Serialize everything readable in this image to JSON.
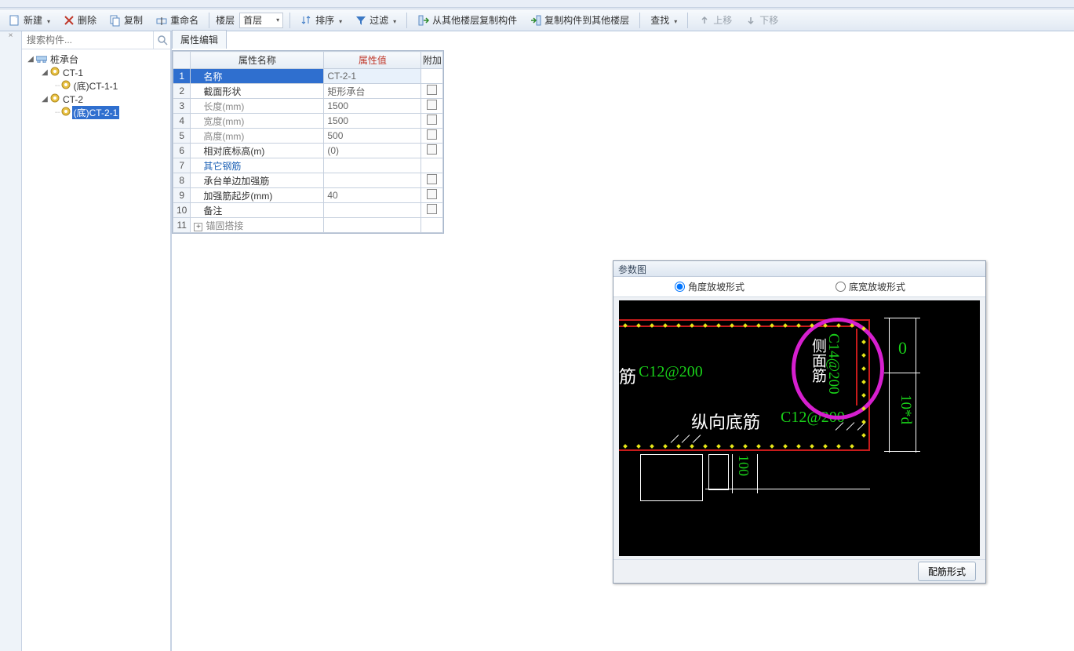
{
  "toolbar": {
    "new": "新建",
    "delete": "删除",
    "copy": "复制",
    "rename": "重命名",
    "floor": "楼层",
    "firstFloor": "首层",
    "sort": "排序",
    "filter": "过滤",
    "copyFromOther": "从其他楼层复制构件",
    "copyToOther": "复制构件到其他楼层",
    "find": "查找",
    "moveUp": "上移",
    "moveDown": "下移"
  },
  "search": {
    "placeholder": "搜索构件..."
  },
  "tree": {
    "root": "桩承台",
    "ct1": "CT-1",
    "ct1child": "(底)CT-1-1",
    "ct2": "CT-2",
    "ct2child": "(底)CT-2-1"
  },
  "propTab": "属性编辑",
  "propHeaders": {
    "name": "属性名称",
    "value": "属性值",
    "extra": "附加"
  },
  "props": {
    "r1": {
      "n": "1",
      "name": "名称",
      "value": "CT-2-1"
    },
    "r2": {
      "n": "2",
      "name": "截面形状",
      "value": "矩形承台"
    },
    "r3": {
      "n": "3",
      "name": "长度(mm)",
      "value": "1500"
    },
    "r4": {
      "n": "4",
      "name": "宽度(mm)",
      "value": "1500"
    },
    "r5": {
      "n": "5",
      "name": "高度(mm)",
      "value": "500"
    },
    "r6": {
      "n": "6",
      "name": "相对底标高(m)",
      "value": "(0)"
    },
    "r7": {
      "n": "7",
      "name": "其它钢筋",
      "value": ""
    },
    "r8": {
      "n": "8",
      "name": "承台单边加强筋",
      "value": ""
    },
    "r9": {
      "n": "9",
      "name": "加强筋起步(mm)",
      "value": "40"
    },
    "r10": {
      "n": "10",
      "name": "备注",
      "value": ""
    },
    "r11": {
      "n": "11",
      "name": "锚固搭接",
      "value": ""
    }
  },
  "diagram": {
    "title": "参数图",
    "radioA": "角度放坡形式",
    "radioB": "底宽放坡形式",
    "btn": "配筋形式",
    "txt": {
      "jin": "筋",
      "c12a": "C12@200",
      "zxdj": "纵向底筋",
      "c12b": "C12@200",
      "cmj": "侧面筋",
      "c14": "C14@200",
      "zero": "0",
      "tenD": "10*d",
      "hund": "100"
    }
  }
}
